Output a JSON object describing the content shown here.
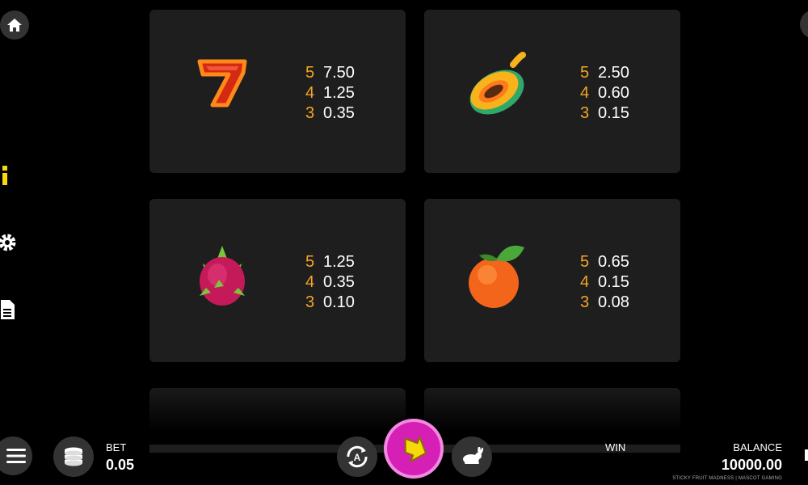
{
  "paytable": [
    {
      "symbol": "seven-icon",
      "pays": [
        {
          "count": "5",
          "value": "7.50"
        },
        {
          "count": "4",
          "value": "1.25"
        },
        {
          "count": "3",
          "value": "0.35"
        }
      ]
    },
    {
      "symbol": "papaya-icon",
      "pays": [
        {
          "count": "5",
          "value": "2.50"
        },
        {
          "count": "4",
          "value": "0.60"
        },
        {
          "count": "3",
          "value": "0.15"
        }
      ]
    },
    {
      "symbol": "dragonfruit-icon",
      "pays": [
        {
          "count": "5",
          "value": "1.25"
        },
        {
          "count": "4",
          "value": "0.35"
        },
        {
          "count": "3",
          "value": "0.10"
        }
      ]
    },
    {
      "symbol": "orange-icon",
      "pays": [
        {
          "count": "5",
          "value": "0.65"
        },
        {
          "count": "4",
          "value": "0.15"
        },
        {
          "count": "3",
          "value": "0.08"
        }
      ]
    }
  ],
  "bottom_bar": {
    "bet_label": "BET",
    "bet_value": "0.05",
    "win_label": "WIN",
    "balance_label": "BALANCE",
    "balance_value": "10000.00",
    "credit": "STICKY FRUIT MADNESS | MASCOT GAMING"
  },
  "colors": {
    "accent": "#f5d90a",
    "pay_count": "#f5a623",
    "spin": "#d61fb4",
    "card": "#1e1e1e"
  }
}
